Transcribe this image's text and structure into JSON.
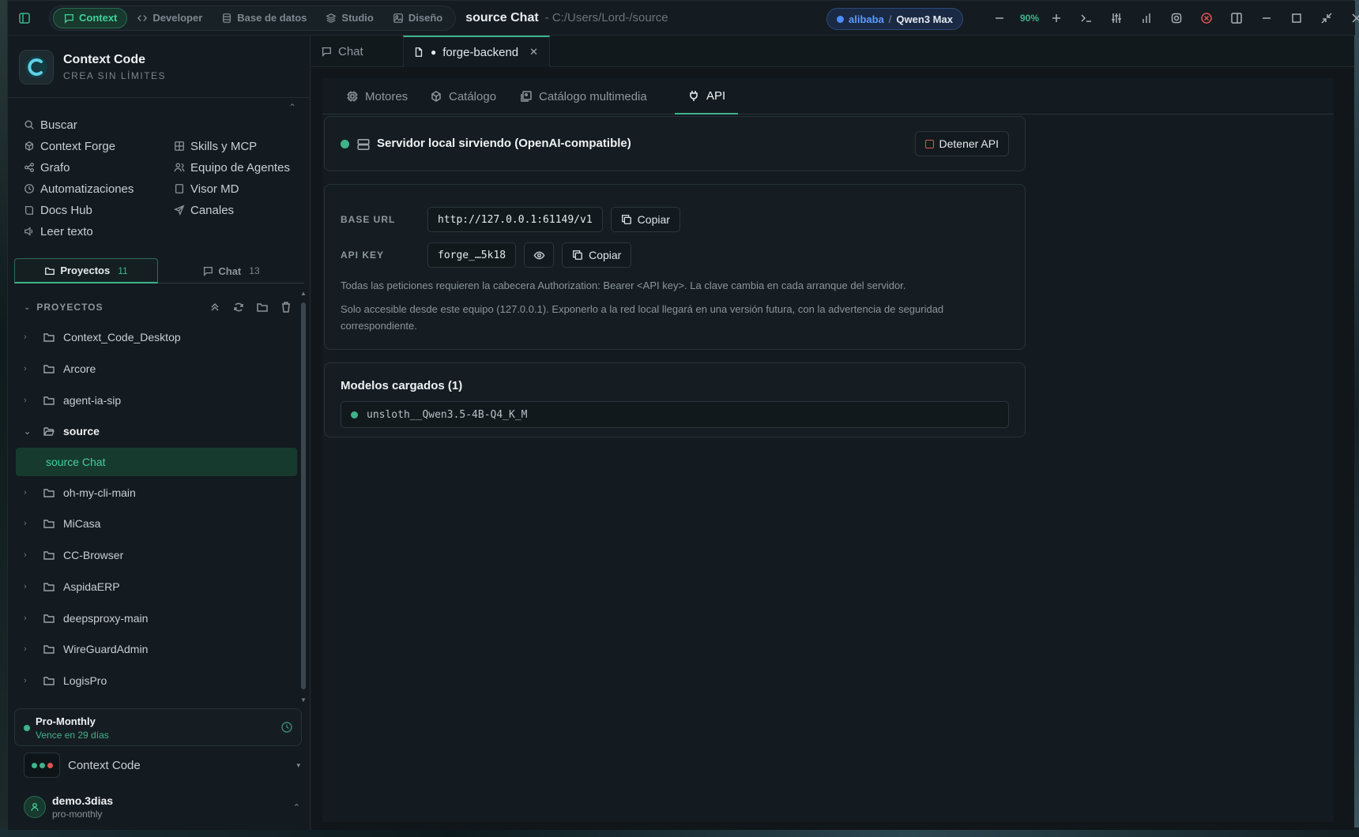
{
  "titlebar": {
    "modes": [
      "Context",
      "Developer",
      "Base de datos",
      "Studio",
      "Diseño"
    ],
    "title": "source Chat",
    "path": "- C:/Users/Lord-/source",
    "provider": "alibaba",
    "separator": "/",
    "model": "Qwen3 Max",
    "zoom": "90%"
  },
  "brand": {
    "name": "Context Code",
    "tagline": "CREA SIN LÍMITES"
  },
  "nav": {
    "left": [
      "Buscar",
      "Context Forge",
      "Grafo",
      "Automatizaciones",
      "Docs Hub",
      "Leer texto"
    ],
    "right": [
      "Skills y MCP",
      "Equipo de Agentes",
      "Visor MD",
      "Canales"
    ]
  },
  "panel_tabs": {
    "projects_label": "Proyectos",
    "projects_count": "11",
    "chat_label": "Chat",
    "chat_count": "13"
  },
  "projects": {
    "header": "PROYECTOS",
    "items": [
      "Context_Code_Desktop",
      "Arcore",
      "agent-ia-sip",
      "source",
      "source Chat",
      "oh-my-cli-main",
      "MiCasa",
      "CC-Browser",
      "AspidaERP",
      "deepsproxy-main",
      "WireGuardAdmin",
      "LogisPro"
    ]
  },
  "plan": {
    "name": "Pro-Monthly",
    "expires": "Vence en 29 días"
  },
  "workspace": {
    "name": "Context Code"
  },
  "user": {
    "name": "demo.3dias",
    "plan": "pro-monthly"
  },
  "editor_tabs": {
    "chat": "Chat",
    "file": "forge-backend"
  },
  "sub_tabs": [
    "Motores",
    "Catálogo",
    "Catálogo multimedia",
    "API"
  ],
  "server": {
    "status": "Servidor local sirviendo (OpenAI-compatible)",
    "stop_label": "Detener API"
  },
  "api": {
    "base_url_label": "BASE URL",
    "base_url": "http://127.0.0.1:61149/v1",
    "api_key_label": "API KEY",
    "api_key": "forge_…5k18",
    "copy_label": "Copiar",
    "note1": "Todas las peticiones requieren la cabecera Authorization: Bearer <API key>. La clave cambia en cada arranque del servidor.",
    "note2": "Solo accesible desde este equipo (127.0.0.1). Exponerlo a la red local llegará en una versión futura, con la advertencia de seguridad correspondiente."
  },
  "models": {
    "title": "Modelos cargados (1)",
    "items": [
      "unsloth__Qwen3.5-4B-Q4_K_M"
    ]
  },
  "colors": {
    "accent": "#3fb38a",
    "danger": "#e05454",
    "provider": "#4c8dff"
  }
}
